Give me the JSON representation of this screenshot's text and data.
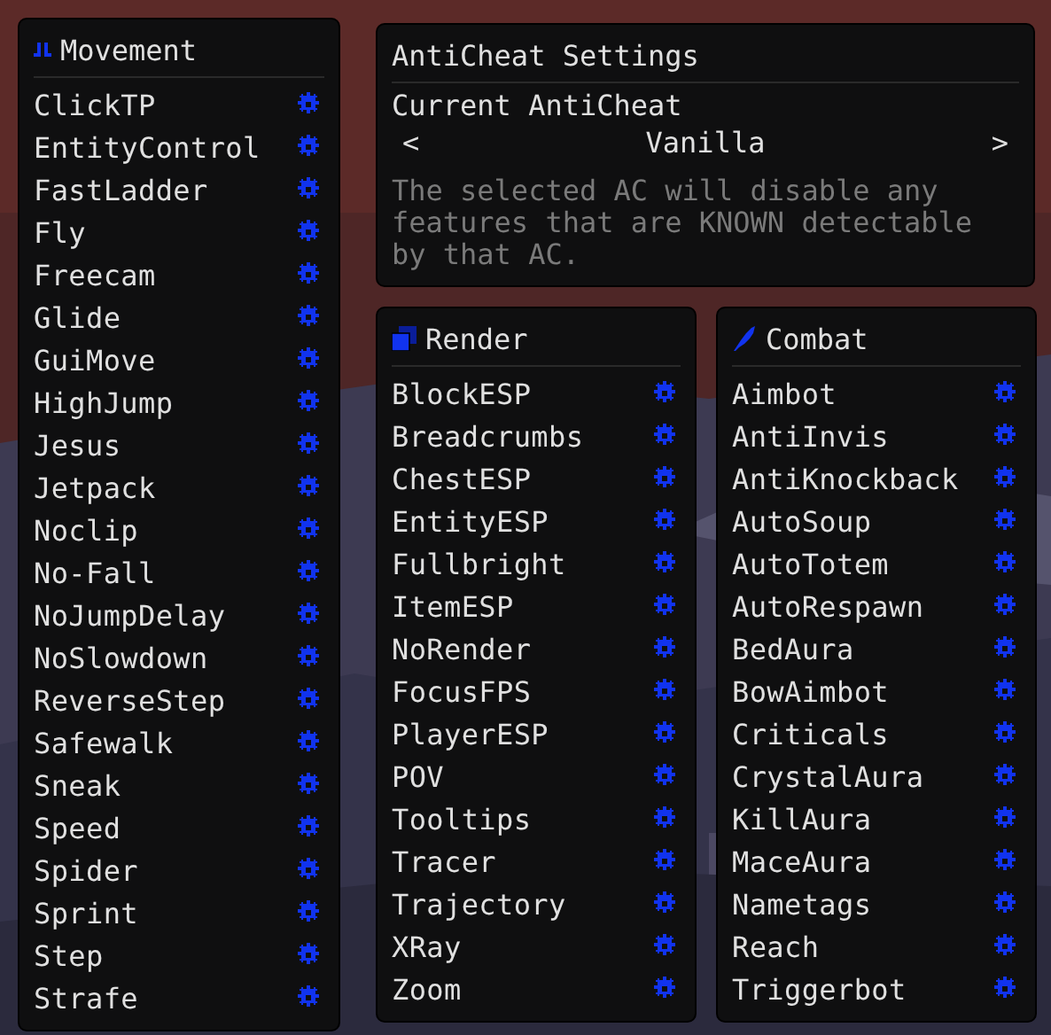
{
  "anticheat": {
    "title": "AntiCheat Settings",
    "label": "Current AntiCheat",
    "prev": "<",
    "value": "Vanilla",
    "next": ">",
    "description": "The selected AC will disable any features that are KNOWN detectable by that AC."
  },
  "categories": [
    {
      "title": "Movement",
      "modules": [
        "ClickTP",
        "EntityControl",
        "FastLadder",
        "Fly",
        "Freecam",
        "Glide",
        "GuiMove",
        "HighJump",
        "Jesus",
        "Jetpack",
        "Noclip",
        "No-Fall",
        "NoJumpDelay",
        "NoSlowdown",
        "ReverseStep",
        "Safewalk",
        "Sneak",
        "Speed",
        "Spider",
        "Sprint",
        "Step",
        "Strafe"
      ]
    },
    {
      "title": "Render",
      "modules": [
        "BlockESP",
        "Breadcrumbs",
        "ChestESP",
        "EntityESP",
        "Fullbright",
        "ItemESP",
        "NoRender",
        "FocusFPS",
        "PlayerESP",
        "POV",
        "Tooltips",
        "Tracer",
        "Trajectory",
        "XRay",
        "Zoom"
      ]
    },
    {
      "title": "Combat",
      "modules": [
        "Aimbot",
        "AntiInvis",
        "AntiKnockback",
        "AutoSoup",
        "AutoTotem",
        "AutoRespawn",
        "BedAura",
        "BowAimbot",
        "Criticals",
        "CrystalAura",
        "KillAura",
        "MaceAura",
        "Nametags",
        "Reach",
        "Triggerbot"
      ]
    }
  ]
}
